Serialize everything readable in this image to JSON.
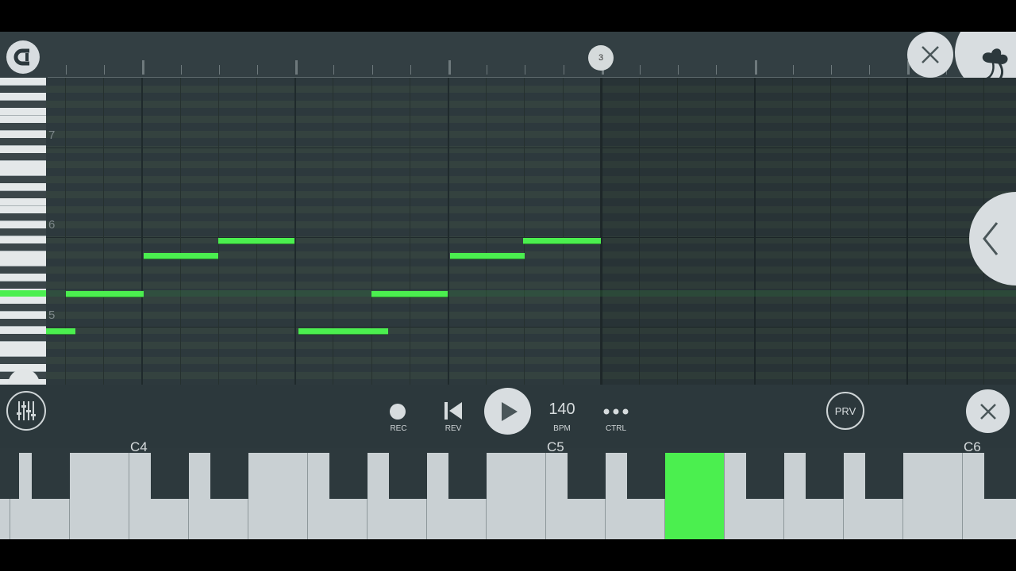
{
  "ruler": {
    "bar_marker": "3"
  },
  "piano_roll": {
    "octave_labels": [
      "7",
      "6",
      "5"
    ],
    "note_color": "#4bef4f"
  },
  "controls": {
    "rec_label": "REC",
    "rev_label": "REV",
    "bpm_value": "140",
    "bpm_label": "BPM",
    "ctrl_label": "CTRL",
    "prv_label": "PRV"
  },
  "keyboard": {
    "octave_labels": [
      "C4",
      "C5",
      "C6"
    ],
    "highlight_color": "#4bef4f"
  },
  "icons": {
    "magnet": "magnet-icon",
    "close": "close-icon",
    "logo": "fruit-logo-icon",
    "collapse": "chevron-left-icon",
    "mixer": "mixer-sliders-icon",
    "play": "play-icon",
    "rewind": "skip-back-icon",
    "more": "more-dots-icon"
  }
}
